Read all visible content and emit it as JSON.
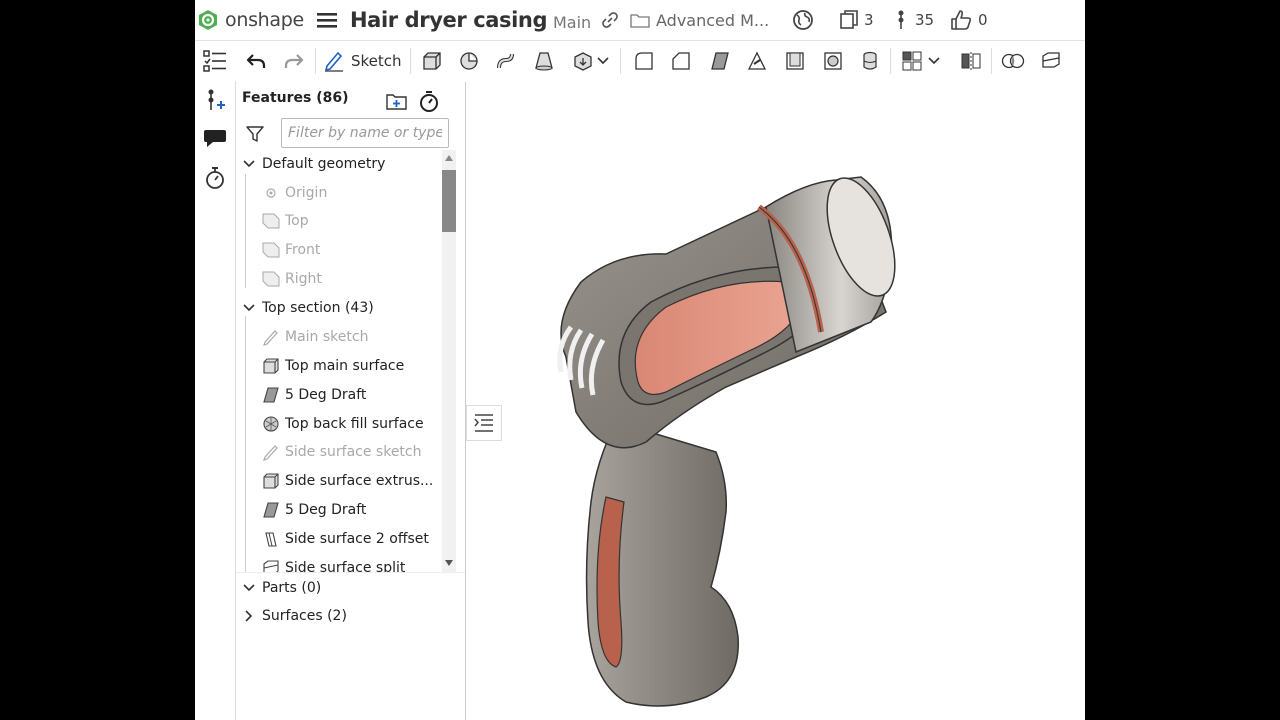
{
  "header": {
    "logo_text": "onshape",
    "doc_title": "Hair dryer casing",
    "branch": "Main",
    "folder": "Advanced M...",
    "versions_count": "3",
    "branches_count": "35",
    "likes_count": "0"
  },
  "toolbar": {
    "sketch_label": "Sketch"
  },
  "panel": {
    "title": "Features (86)",
    "filter_placeholder": "Filter by name or type",
    "groups": {
      "default_geometry": "Default geometry",
      "top_section": "Top section (43)",
      "parts": "Parts (0)",
      "surfaces": "Surfaces (2)"
    },
    "items": [
      {
        "label": "Origin",
        "icon": "origin-icon",
        "dim": true
      },
      {
        "label": "Top",
        "icon": "plane-icon",
        "dim": true
      },
      {
        "label": "Front",
        "icon": "plane-icon",
        "dim": true
      },
      {
        "label": "Right",
        "icon": "plane-icon",
        "dim": true
      },
      {
        "label": "Main sketch",
        "icon": "sketch-icon",
        "dim": true
      },
      {
        "label": "Top main surface",
        "icon": "extrude-icon",
        "dim": false
      },
      {
        "label": "5 Deg Draft",
        "icon": "draft-icon",
        "dim": false
      },
      {
        "label": "Top back fill surface",
        "icon": "fill-icon",
        "dim": false
      },
      {
        "label": "Side surface sketch",
        "icon": "sketch-icon",
        "dim": true
      },
      {
        "label": "Side surface extrus...",
        "icon": "extrude-icon",
        "dim": false
      },
      {
        "label": "5 Deg Draft",
        "icon": "draft-icon",
        "dim": false
      },
      {
        "label": "Side surface 2 offset",
        "icon": "offset-icon",
        "dim": false
      },
      {
        "label": "Side surface split",
        "icon": "split-icon",
        "dim": false
      }
    ]
  },
  "colors": {
    "accent_green": "#4caf50",
    "panel_copper": "#e8998a",
    "body_gray": "#8f8a84"
  }
}
